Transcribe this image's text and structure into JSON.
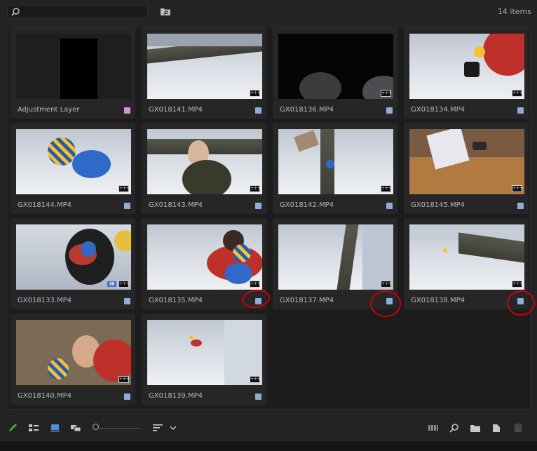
{
  "toolbar": {
    "search_placeholder": "",
    "item_count": "14 items"
  },
  "clips": [
    {
      "name": "Adjustment Layer",
      "label_color": "#d98ee0"
    },
    {
      "name": "GX018141.MP4",
      "label_color": "#8eadd8"
    },
    {
      "name": "GX018136.MP4",
      "label_color": "#8eadd8"
    },
    {
      "name": "GX018134.MP4",
      "label_color": "#8eadd8"
    },
    {
      "name": "GX018144.MP4",
      "label_color": "#8eadd8"
    },
    {
      "name": "GX018143.MP4",
      "label_color": "#8eadd8"
    },
    {
      "name": "GX018142.MP4",
      "label_color": "#8eadd8"
    },
    {
      "name": "GX018145.MP4",
      "label_color": "#8eadd8"
    },
    {
      "name": "GX018133.MP4",
      "label_color": "#8eadd8"
    },
    {
      "name": "GX018135.MP4",
      "label_color": "#8eadd8"
    },
    {
      "name": "GX018137.MP4",
      "label_color": "#8eadd8"
    },
    {
      "name": "GX018138.MP4",
      "label_color": "#8eadd8"
    },
    {
      "name": "GX018140.MP4",
      "label_color": "#8eadd8"
    },
    {
      "name": "GX018139.MP4",
      "label_color": "#8eadd8"
    }
  ],
  "badges": {
    "audio": "+++",
    "video": "▮▮"
  },
  "colors": {
    "annotation": "#d00000",
    "accent_blue": "#4a90e2",
    "pencil_green": "#3cb14a"
  },
  "icons": [
    "search-icon",
    "new-bin-icon",
    "pencil-icon",
    "list-view-icon",
    "icon-view-icon",
    "freeform-view-icon",
    "zoom-slider",
    "sort-icon",
    "automate-to-sequence-icon",
    "find-icon",
    "new-bin-folder-icon",
    "new-item-icon",
    "trash-icon"
  ]
}
